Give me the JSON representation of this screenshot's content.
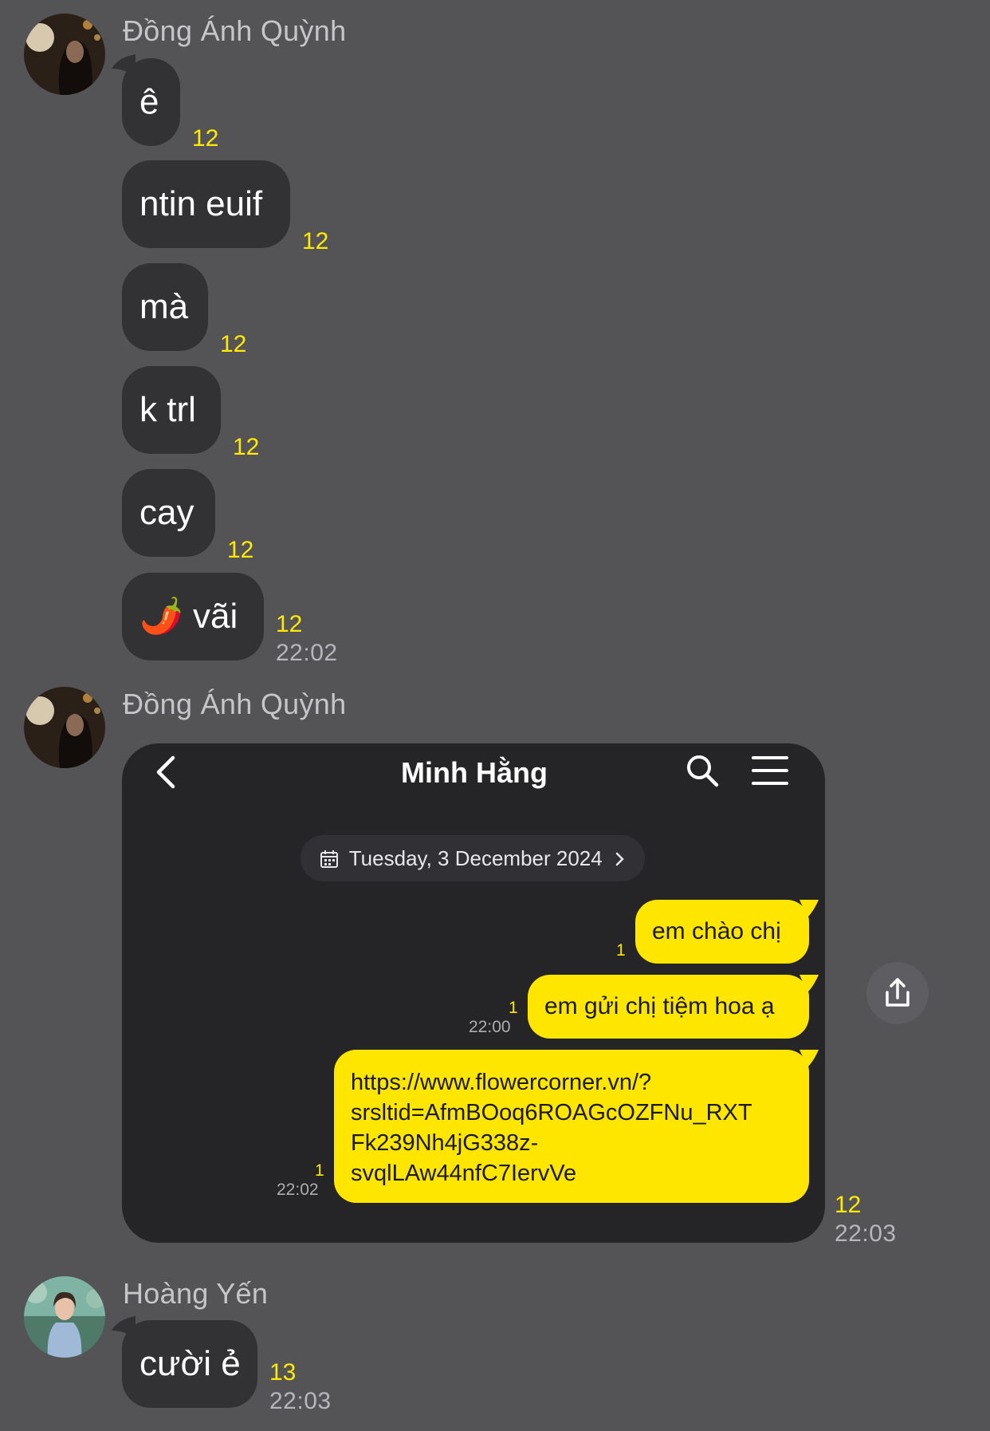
{
  "groups": [
    {
      "sender": "Đồng Ánh Quỳnh",
      "messages": [
        {
          "text": "ê",
          "count": "12"
        },
        {
          "text": "ntin euif",
          "count": "12"
        },
        {
          "text": "mà",
          "count": "12"
        },
        {
          "text": "k trl",
          "count": "12"
        },
        {
          "text": "cay",
          "count": "12"
        },
        {
          "text": "🌶️ vãi",
          "count": "12",
          "time": "22:02"
        }
      ]
    },
    {
      "sender": "Đồng Ánh Quỳnh",
      "image_count": "12",
      "image_time": "22:03",
      "screenshot": {
        "title": "Minh Hằng",
        "date": "Tuesday, 3 December 2024",
        "messages": [
          {
            "text": "em chào chị",
            "count": "1"
          },
          {
            "text": "em gửi chị tiệm hoa ạ",
            "count": "1",
            "time": "22:00"
          },
          {
            "lines": [
              "https://www.flowercorner.vn/?",
              "srsltid=AfmBOoq6ROAGcOZFNu_RXT",
              "Fk239Nh4jG338z-",
              "svqlLAw44nfC7IervVe"
            ],
            "count": "1",
            "time": "22:02"
          }
        ]
      }
    },
    {
      "sender": "Hoàng Yến",
      "messages": [
        {
          "text": "cười ẻ",
          "count": "13",
          "time": "22:03"
        }
      ]
    }
  ],
  "colors": {
    "background": "#545356",
    "bubble": "#323134",
    "count": "#ffea00",
    "my_bubble": "#ffe600"
  },
  "icons": [
    "back-arrow-icon",
    "search-icon",
    "menu-icon",
    "calendar-icon",
    "chevron-right-icon",
    "share-icon"
  ]
}
